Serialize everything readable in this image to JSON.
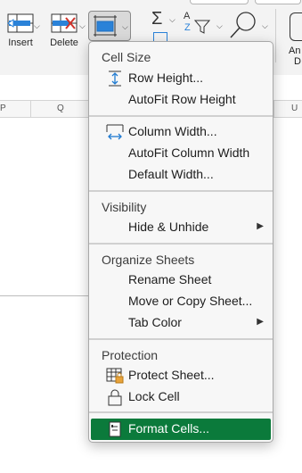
{
  "ribbon": {
    "insert_label": "Insert",
    "delete_label": "Delete",
    "right_label_1": "An",
    "right_label_2": "D",
    "sort_glyph_a": "A",
    "sort_glyph_z": "Z"
  },
  "columns": {
    "p": "P",
    "q": "Q",
    "u": "U"
  },
  "menu": {
    "cell_size_header": "Cell Size",
    "row_height": "Row Height...",
    "autofit_row_height": "AutoFit Row Height",
    "column_width": "Column Width...",
    "autofit_column_width": "AutoFit Column Width",
    "default_width": "Default Width...",
    "visibility_header": "Visibility",
    "hide_unhide": "Hide & Unhide",
    "organize_header": "Organize Sheets",
    "rename_sheet": "Rename Sheet",
    "move_copy_sheet": "Move or Copy Sheet...",
    "tab_color": "Tab Color",
    "protection_header": "Protection",
    "protect_sheet": "Protect Sheet...",
    "lock_cell": "Lock Cell",
    "format_cells": "Format Cells..."
  },
  "colors": {
    "highlight": "#0b7a3b",
    "accent_blue": "#1f7ad1"
  }
}
